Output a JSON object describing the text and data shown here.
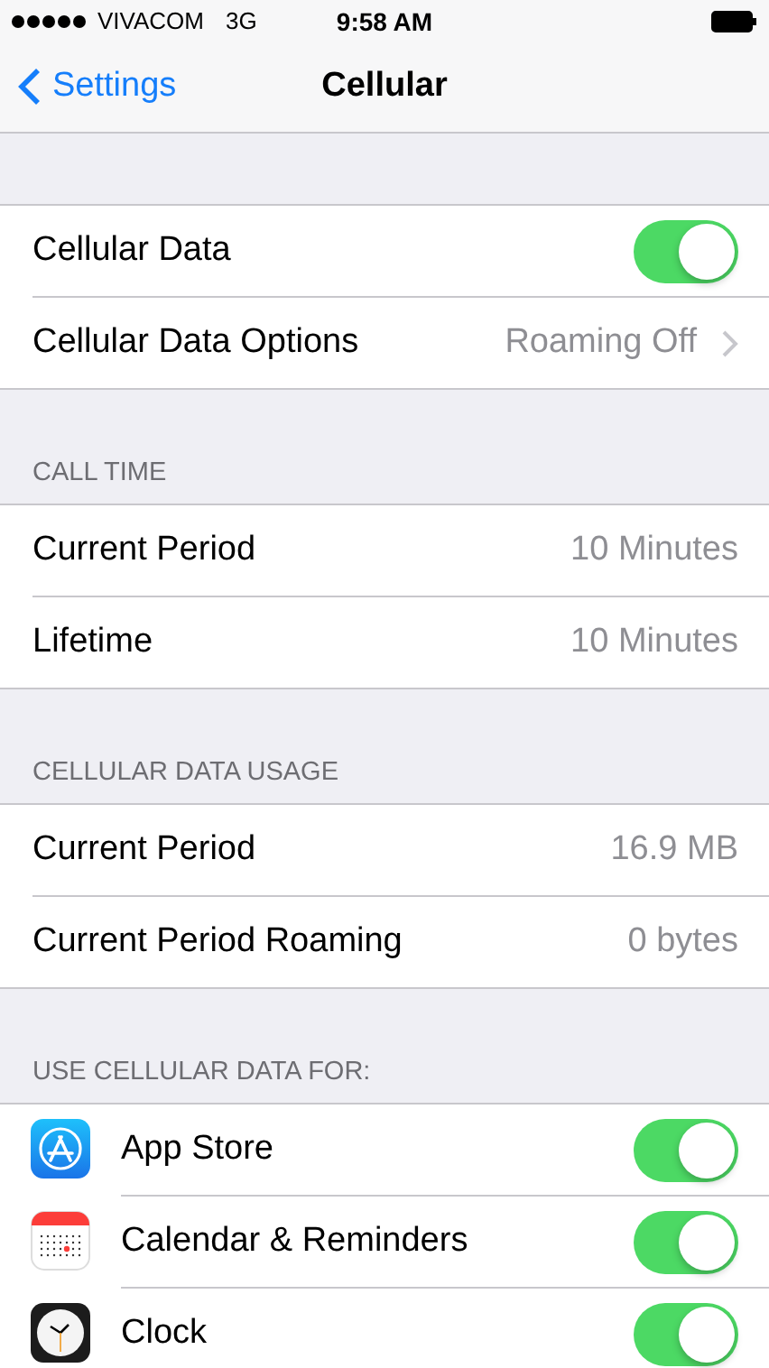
{
  "status_bar": {
    "carrier": "VIVACOM",
    "network": "3G",
    "time": "9:58 AM"
  },
  "nav_bar": {
    "back": "Settings",
    "title": "Cellular"
  },
  "sections": [
    {
      "rows": [
        {
          "kind": "toggle",
          "label": "Cellular Data",
          "on": true
        },
        {
          "kind": "detail",
          "label": "Cellular Data Options",
          "value": "Roaming Off"
        }
      ]
    },
    {
      "header": "CALL TIME",
      "rows": [
        {
          "kind": "value",
          "label": "Current Period",
          "value": "10 Minutes"
        },
        {
          "kind": "value",
          "label": "Lifetime",
          "value": "10 Minutes"
        }
      ]
    },
    {
      "header": "CELLULAR DATA USAGE",
      "rows": [
        {
          "kind": "value",
          "label": "Current Period",
          "value": "16.9 MB"
        },
        {
          "kind": "value",
          "label": "Current Period Roaming",
          "value": "0 bytes"
        }
      ]
    },
    {
      "header": "USE CELLULAR DATA FOR:",
      "rows": [
        {
          "kind": "app",
          "label": "App Store",
          "on": true
        },
        {
          "kind": "app",
          "label": "Calendar & Reminders",
          "on": true
        },
        {
          "kind": "app",
          "label": "Clock",
          "on": true
        }
      ]
    }
  ]
}
